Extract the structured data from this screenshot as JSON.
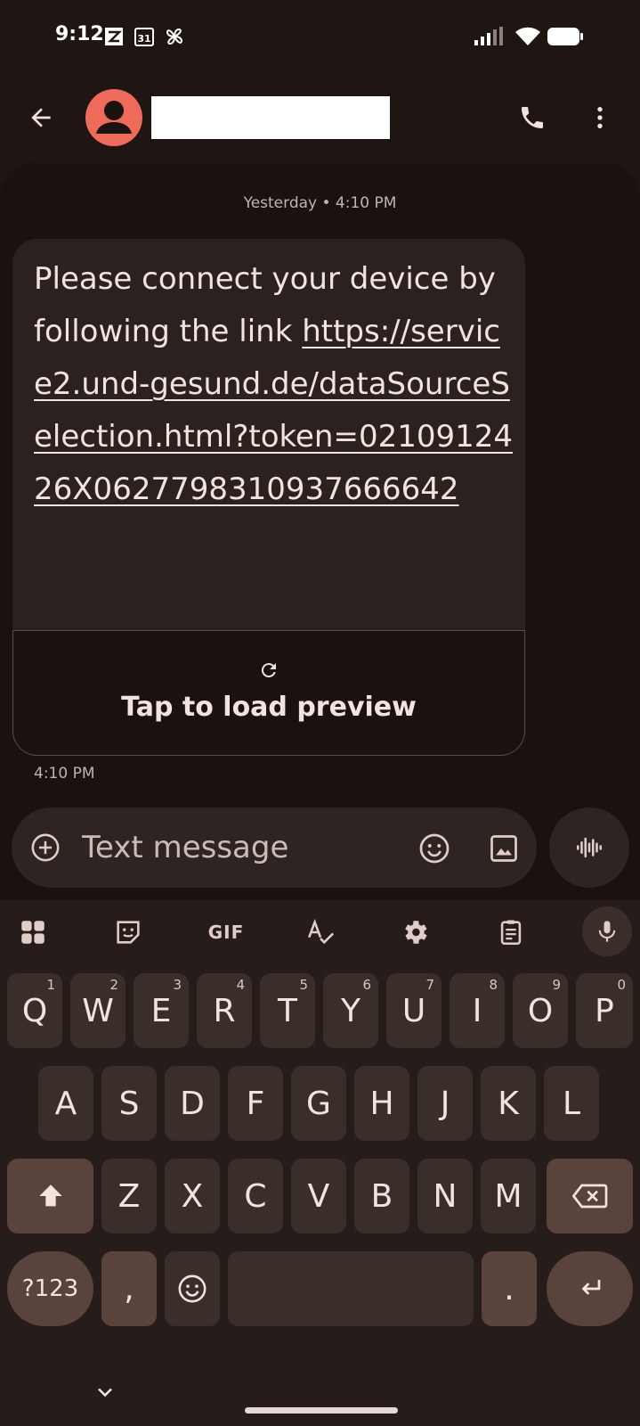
{
  "status_bar": {
    "time": "9:12",
    "icons_left": [
      "z-app-icon",
      "calendar-31-icon",
      "pinwheel-icon"
    ],
    "calendar_day": "31",
    "icons_right": [
      "signal-icon",
      "wifi-icon",
      "battery-icon"
    ]
  },
  "header": {
    "contact_name": "",
    "icons": [
      "back-arrow-icon",
      "person-icon",
      "phone-icon",
      "more-vert-icon"
    ]
  },
  "conversation": {
    "date_separator": "Yesterday • 4:10 PM",
    "message": {
      "text": "Please connect your device by following the link",
      "link": "https://service2.und-gesund.de/dataSourceSelection.html?token=0210912426X0627798310937666642",
      "preview_label": "Tap to load preview",
      "time": "4:10 PM"
    }
  },
  "compose": {
    "placeholder": "Text message",
    "icons": [
      "add-circle-icon",
      "emoji-icon",
      "image-icon",
      "voice-icon"
    ]
  },
  "keyboard": {
    "toolbar": [
      "apps-grid-icon",
      "sticker-icon",
      "GIF",
      "spellcheck-icon",
      "settings-icon",
      "clipboard-icon",
      "mic-icon"
    ],
    "gif_label": "GIF",
    "row1": [
      {
        "key": "Q",
        "hint": "1"
      },
      {
        "key": "W",
        "hint": "2"
      },
      {
        "key": "E",
        "hint": "3"
      },
      {
        "key": "R",
        "hint": "4"
      },
      {
        "key": "T",
        "hint": "5"
      },
      {
        "key": "Y",
        "hint": "6"
      },
      {
        "key": "U",
        "hint": "7"
      },
      {
        "key": "I",
        "hint": "8"
      },
      {
        "key": "O",
        "hint": "9"
      },
      {
        "key": "P",
        "hint": "0"
      }
    ],
    "row2": [
      "A",
      "S",
      "D",
      "F",
      "G",
      "H",
      "J",
      "K",
      "L"
    ],
    "row3": [
      "Z",
      "X",
      "C",
      "V",
      "B",
      "N",
      "M"
    ],
    "symbols_label": "?123",
    "comma": ",",
    "period": "."
  },
  "colors": {
    "background": "#1f1614",
    "bubble": "#2b211f",
    "avatar": "#ee6a5a",
    "key": "#3a2e2b",
    "special_key": "#5a433d",
    "text": "#f3e3df"
  }
}
